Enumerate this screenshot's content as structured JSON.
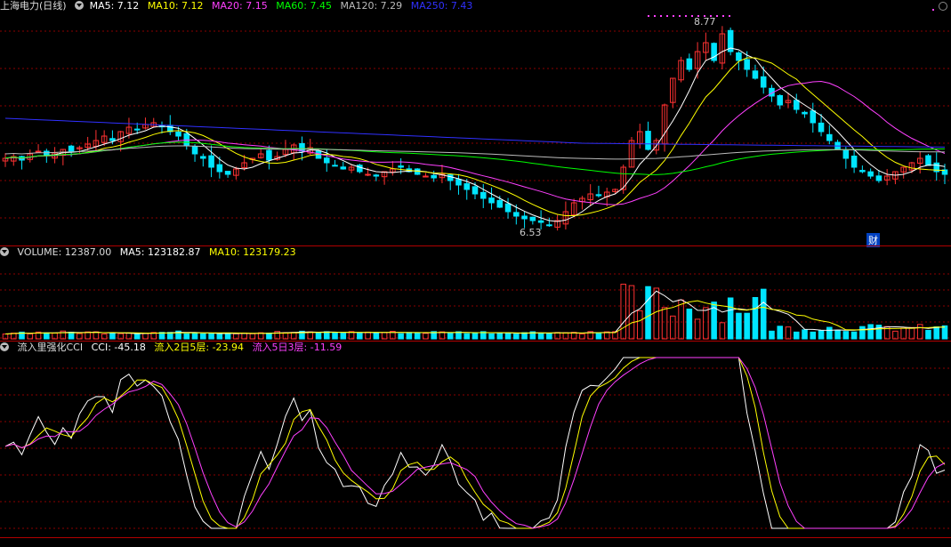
{
  "price_header": {
    "title": "上海电力(日线)",
    "ma5": "MA5: 7.12",
    "ma10": "MA10: 7.12",
    "ma20": "MA20: 7.15",
    "ma60": "MA60: 7.45",
    "ma120": "MA120: 7.29",
    "ma250": "MA250: 7.43"
  },
  "price_annotations": {
    "high": "8.77",
    "low": "6.53",
    "badge": "财"
  },
  "volume_header": {
    "volume": "VOLUME: 12387.00",
    "ma5": "MA5: 123182.87",
    "ma10": "MA10: 123179.23"
  },
  "indicator_header": {
    "name": "流入里强化CCI",
    "cci": "CCI: -45.18",
    "in2": "流入2日5层: -23.94",
    "in5": "流入5日3层: -11.59"
  },
  "colors": {
    "up": "#ff3232",
    "down": "#00e5ff",
    "ma5": "#ffffff",
    "ma10": "#ffff00",
    "ma20": "#ff40ff",
    "ma60": "#00ff00",
    "ma120": "#bbbbbb",
    "ma250": "#3030ff",
    "grid": "#8b0000"
  },
  "chart_data": {
    "type": "candlestick",
    "ylim": [
      6.4,
      8.9
    ],
    "price_high": 8.77,
    "price_low": 6.53,
    "closes": [
      7.3,
      7.32,
      7.28,
      7.35,
      7.38,
      7.33,
      7.36,
      7.4,
      7.37,
      7.42,
      7.46,
      7.5,
      7.55,
      7.5,
      7.6,
      7.65,
      7.62,
      7.68,
      7.7,
      7.66,
      7.6,
      7.55,
      7.45,
      7.35,
      7.3,
      7.2,
      7.15,
      7.12,
      7.18,
      7.25,
      7.3,
      7.35,
      7.28,
      7.32,
      7.4,
      7.45,
      7.38,
      7.42,
      7.3,
      7.25,
      7.22,
      7.18,
      7.2,
      7.15,
      7.12,
      7.1,
      7.15,
      7.18,
      7.2,
      7.15,
      7.12,
      7.1,
      7.08,
      7.12,
      7.05,
      7.0,
      6.95,
      6.9,
      6.85,
      6.8,
      6.75,
      6.7,
      6.65,
      6.62,
      6.6,
      6.58,
      6.55,
      6.6,
      6.7,
      6.8,
      6.85,
      6.9,
      6.88,
      6.92,
      6.95,
      7.2,
      7.5,
      7.6,
      7.4,
      7.5,
      7.9,
      8.2,
      8.4,
      8.3,
      8.5,
      8.6,
      8.4,
      8.7,
      8.5,
      8.4,
      8.3,
      8.2,
      8.1,
      8.0,
      7.9,
      7.95,
      7.85,
      7.8,
      7.7,
      7.6,
      7.5,
      7.4,
      7.3,
      7.2,
      7.15,
      7.1,
      7.05,
      7.1,
      7.15,
      7.2,
      7.25,
      7.3,
      7.22,
      7.15,
      7.12
    ],
    "volume_ylim": [
      0,
      300000
    ],
    "cci_ylim": [
      -250,
      250
    ]
  }
}
